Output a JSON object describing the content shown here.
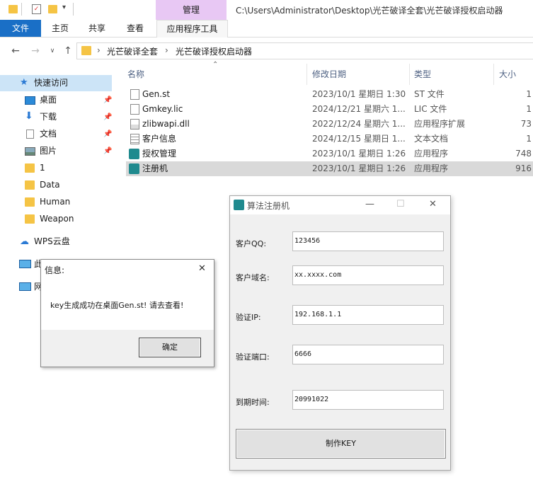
{
  "window": {
    "manage_tab": "管理",
    "path_title": "C:\\Users\\Administrator\\Desktop\\光芒破译全套\\光芒破译授权启动器"
  },
  "ribbon": {
    "tabs": [
      "文件",
      "主页",
      "共享",
      "查看",
      "应用程序工具"
    ]
  },
  "address": {
    "crumbs": [
      "光芒破译全套",
      "光芒破译授权启动器"
    ]
  },
  "sidebar": {
    "quick_access": "快速访问",
    "items": [
      "桌面",
      "下载",
      "文档",
      "图片",
      "1",
      "Data",
      "Human",
      "Weapon"
    ],
    "wps": "WPS云盘",
    "this_pc": "此",
    "network": "网"
  },
  "columns": [
    "名称",
    "修改日期",
    "类型",
    "大小"
  ],
  "files": [
    {
      "name": "Gen.st",
      "date": "2023/10/1 星期日 1:30",
      "type": "ST 文件",
      "size": "1"
    },
    {
      "name": "Gmkey.lic",
      "date": "2024/12/21 星期六 1...",
      "type": "LIC 文件",
      "size": "1"
    },
    {
      "name": "zlibwapi.dll",
      "date": "2022/12/24 星期六 1...",
      "type": "应用程序扩展",
      "size": "73"
    },
    {
      "name": "客户信息",
      "date": "2024/12/15 星期日 1...",
      "type": "文本文档",
      "size": "1"
    },
    {
      "name": "授权管理",
      "date": "2023/10/1 星期日 1:26",
      "type": "应用程序",
      "size": "748"
    },
    {
      "name": "注册机",
      "date": "2023/10/1 星期日 1:26",
      "type": "应用程序",
      "size": "916"
    }
  ],
  "info_dialog": {
    "title": "信息:",
    "message": "key生成成功在桌面Gen.st! 请去查看!",
    "ok": "确定",
    "close": "✕"
  },
  "gen_dialog": {
    "title": "算法注册机",
    "fields": [
      {
        "label": "客户QQ:",
        "value": "123456"
      },
      {
        "label": "客户域名:",
        "value": "xx.xxxx.com"
      },
      {
        "label": "验证IP:",
        "value": "192.168.1.1"
      },
      {
        "label": "验证端口:",
        "value": "6666"
      },
      {
        "label": "到期时间:",
        "value": "20991022"
      }
    ],
    "button": "制作KEY",
    "minimize": "—",
    "maximize": "☐",
    "close": "✕"
  },
  "colors": {
    "accent": "#1a6fc6",
    "manage_tab": "#e8c8f4",
    "selection": "#d9d9d9"
  }
}
